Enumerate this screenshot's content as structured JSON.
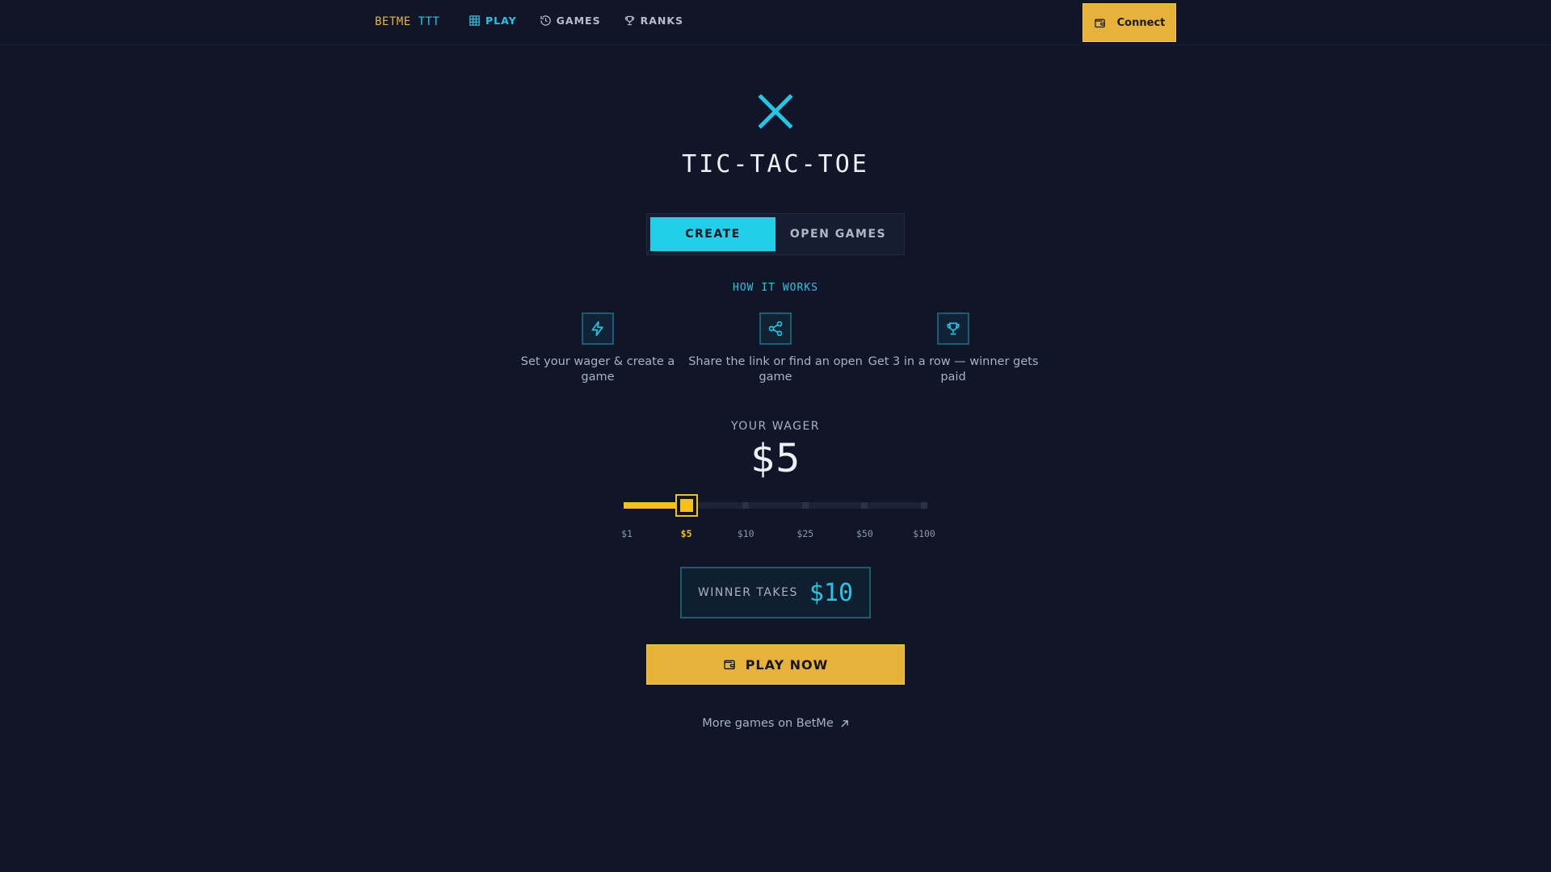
{
  "header": {
    "brand_part1": "BETME",
    "brand_part2": "TTT",
    "nav": [
      {
        "label": "PLAY",
        "icon": "grid-icon",
        "active": true
      },
      {
        "label": "GAMES",
        "icon": "history-icon",
        "active": false
      },
      {
        "label": "RANKS",
        "icon": "trophy-icon",
        "active": false
      }
    ],
    "connect_label": "Connect"
  },
  "hero": {
    "title": "TIC-TAC-TOE",
    "icon": "x-mark-icon"
  },
  "tabs": [
    {
      "label": "CREATE",
      "active": true
    },
    {
      "label": "OPEN GAMES",
      "active": false
    }
  ],
  "how_it_works": {
    "title": "HOW IT WORKS",
    "steps": [
      {
        "icon": "lightning-icon",
        "text": "Set your wager & create a game"
      },
      {
        "icon": "share-icon",
        "text": "Share the link or find an open game"
      },
      {
        "icon": "trophy-icon",
        "text": "Get 3 in a row — winner gets paid"
      }
    ]
  },
  "wager": {
    "label": "YOUR WAGER",
    "value": "$5",
    "options": [
      "$1",
      "$5",
      "$10",
      "$25",
      "$50",
      "$100"
    ],
    "selected_index": 1
  },
  "winner": {
    "label": "WINNER TAKES",
    "value": "$10"
  },
  "play_label": "PLAY NOW",
  "more_link": "More games on BetMe",
  "colors": {
    "background": "#101628",
    "accent_cyan": "#22c7e6",
    "accent_gold": "#e6b23a",
    "slider_gold": "#f5c116"
  }
}
